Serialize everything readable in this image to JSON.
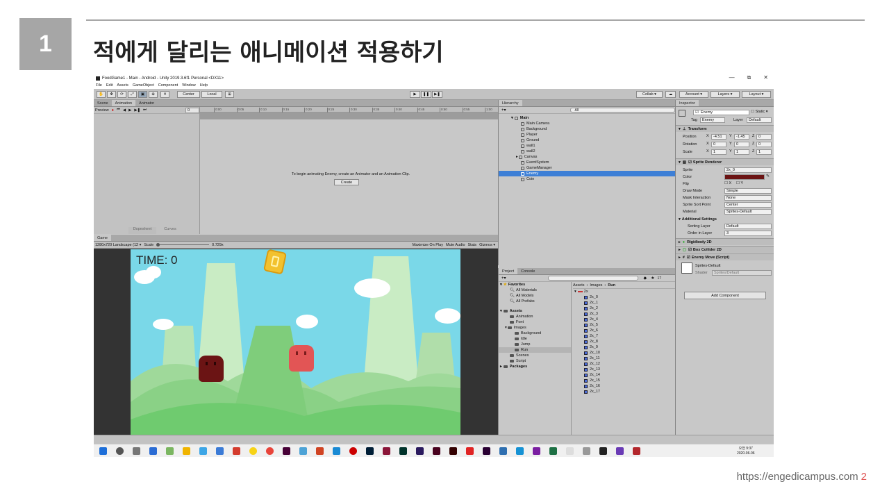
{
  "slide": {
    "number": "1",
    "title": "적에게 달리는 애니메이션 적용하기",
    "footer_url": "https://engedicampus.com",
    "page": "2"
  },
  "window": {
    "title": "FoodGame1 - Main - Android - Unity 2019.3.6f1 Personal <DX11>",
    "min": "—",
    "max": "⧉",
    "close": "✕"
  },
  "menu": [
    "File",
    "Edit",
    "Assets",
    "GameObject",
    "Component",
    "Window",
    "Help"
  ],
  "toolbar": {
    "center": "Center",
    "local": "Local",
    "collab": "Collab ▾",
    "account": "Account ▾",
    "layers": "Layers ▾",
    "layout": "Layout ▾"
  },
  "animation": {
    "tabs": [
      "Scene",
      "Animation",
      "Animator"
    ],
    "preview": "Preview",
    "frame": "0",
    "ruler": [
      "0:00",
      "0:05",
      "0:10",
      "0:15",
      "0:20",
      "0:25",
      "0:30",
      "0:35",
      "0:40",
      "0:45",
      "0:50",
      "0:55",
      "1:00"
    ],
    "message": "To begin animating Enemy, create an Animator and an Animation Clip.",
    "create": "Create",
    "dopesheet": "Dopesheet",
    "curves": "Curves"
  },
  "game": {
    "tab": "Game",
    "resolution": "1280x720 Landscape (12 ▾",
    "scale_label": "Scale",
    "scale_value": "0.729x",
    "maximize": "Maximize On Play",
    "mute": "Mute Audio",
    "stats": "Stats",
    "gizmos": "Gizmos ▾",
    "time_text": "TIME: 0"
  },
  "hierarchy": {
    "tab": "Hierarchy",
    "search": "All",
    "root": "Main",
    "items": [
      "Main Camera",
      "Background",
      "Player",
      "Ground",
      "wall1",
      "wall2",
      "Canvas",
      "EventSystem",
      "GameManager",
      "Enemy",
      "Coin"
    ],
    "selected": "Enemy"
  },
  "inspector": {
    "tab": "Inspector",
    "name": "Enemy",
    "static": "Static ▾",
    "tag_label": "Tag",
    "tag": "Enemy",
    "layer_label": "Layer",
    "layer": "Default",
    "transform": "Transform",
    "position": {
      "label": "Position",
      "x": "-4.51",
      "y": "-1.45",
      "z": "0"
    },
    "rotation": {
      "label": "Rotation",
      "x": "0",
      "y": "0",
      "z": "0"
    },
    "scale": {
      "label": "Scale",
      "x": "1",
      "y": "1",
      "z": "1"
    },
    "sprite_renderer": "Sprite Renderer",
    "sprite_label": "Sprite",
    "sprite": "2x_0",
    "color_label": "Color",
    "color_value": "#6b1414",
    "flip_label": "Flip",
    "flip_x": "X",
    "flip_y": "Y",
    "draw_mode_label": "Draw Mode",
    "draw_mode": "Simple",
    "mask_label": "Mask Interaction",
    "mask": "None",
    "sort_point_label": "Sprite Sort Point",
    "sort_point": "Center",
    "material_label": "Material",
    "material": "Sprites-Default",
    "additional": "Additional Settings",
    "sorting_layer_label": "Sorting Layer",
    "sorting_layer": "Default",
    "order_label": "Order in Layer",
    "order": "3",
    "rigidbody": "Rigidbody 2D",
    "box_collider": "Box Collider 2D",
    "enemy_move": "Enemy Move (Script)",
    "mat_name": "Sprites-Default",
    "shader_label": "Shader",
    "shader": "Sprites/Default",
    "add_component": "Add Component"
  },
  "project": {
    "tabs": [
      "Project",
      "Console"
    ],
    "count": "17",
    "favorites": "Favorites",
    "fav_items": [
      "All Materials",
      "All Models",
      "All Prefabs"
    ],
    "assets": "Assets",
    "asset_items": [
      "Animation",
      "Font",
      "Images",
      "Background",
      "Idle",
      "Jump",
      "Run",
      "Scenes",
      "Script"
    ],
    "packages": "Packages",
    "breadcrumb": [
      "Assets",
      "Images",
      "Run"
    ],
    "sheet": "2x",
    "sprites": [
      "2x_0",
      "2x_1",
      "2x_2",
      "2x_3",
      "2x_4",
      "2x_5",
      "2x_6",
      "2x_7",
      "2x_8",
      "2x_9",
      "2x_10",
      "2x_11",
      "2x_12",
      "2x_13",
      "2x_14",
      "2x_15",
      "2x_16",
      "2x_17"
    ]
  },
  "taskbar": {
    "time": "오전 9:37",
    "date": "2020-06-06"
  }
}
